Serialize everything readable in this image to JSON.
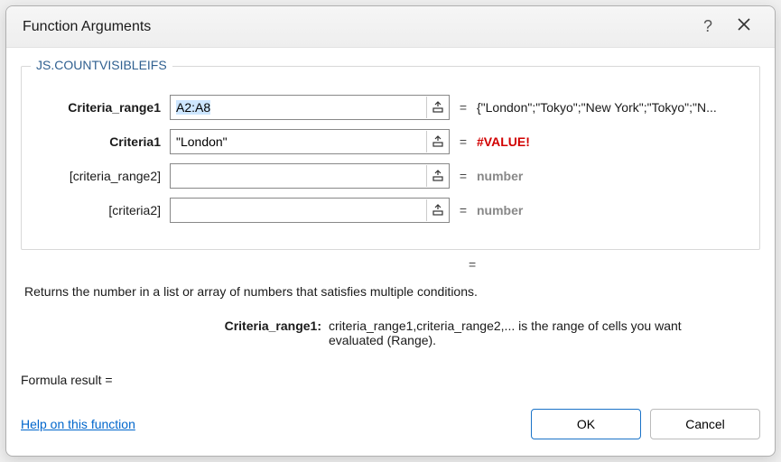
{
  "dialog": {
    "title": "Function Arguments",
    "help_tooltip": "?",
    "function_name": "JS.COUNTVISIBLEIFS"
  },
  "args": [
    {
      "label": "Criteria_range1",
      "bold": true,
      "value": "A2:A8",
      "selected": true,
      "preview": "{\"London\";\"Tokyo\";\"New York\";\"Tokyo\";\"N...",
      "preview_kind": "normal"
    },
    {
      "label": "Criteria1",
      "bold": true,
      "value": "\"London\"",
      "selected": false,
      "preview": "#VALUE!",
      "preview_kind": "error"
    },
    {
      "label": "[criteria_range2]",
      "bold": false,
      "value": "",
      "selected": false,
      "preview": "number",
      "preview_kind": "hint"
    },
    {
      "label": "[criteria2]",
      "bold": false,
      "value": "",
      "selected": false,
      "preview": "number",
      "preview_kind": "hint"
    }
  ],
  "description": {
    "function": "Returns the number in a list or array of numbers that satisfies multiple conditions.",
    "current_arg_name": "Criteria_range1:",
    "current_arg_text": "criteria_range1,criteria_range2,... is the range of cells you want evaluated (Range)."
  },
  "result": {
    "label": "Formula result =",
    "value": ""
  },
  "footer": {
    "help_link": "Help on this function",
    "ok": "OK",
    "cancel": "Cancel"
  },
  "eq_symbol": "="
}
